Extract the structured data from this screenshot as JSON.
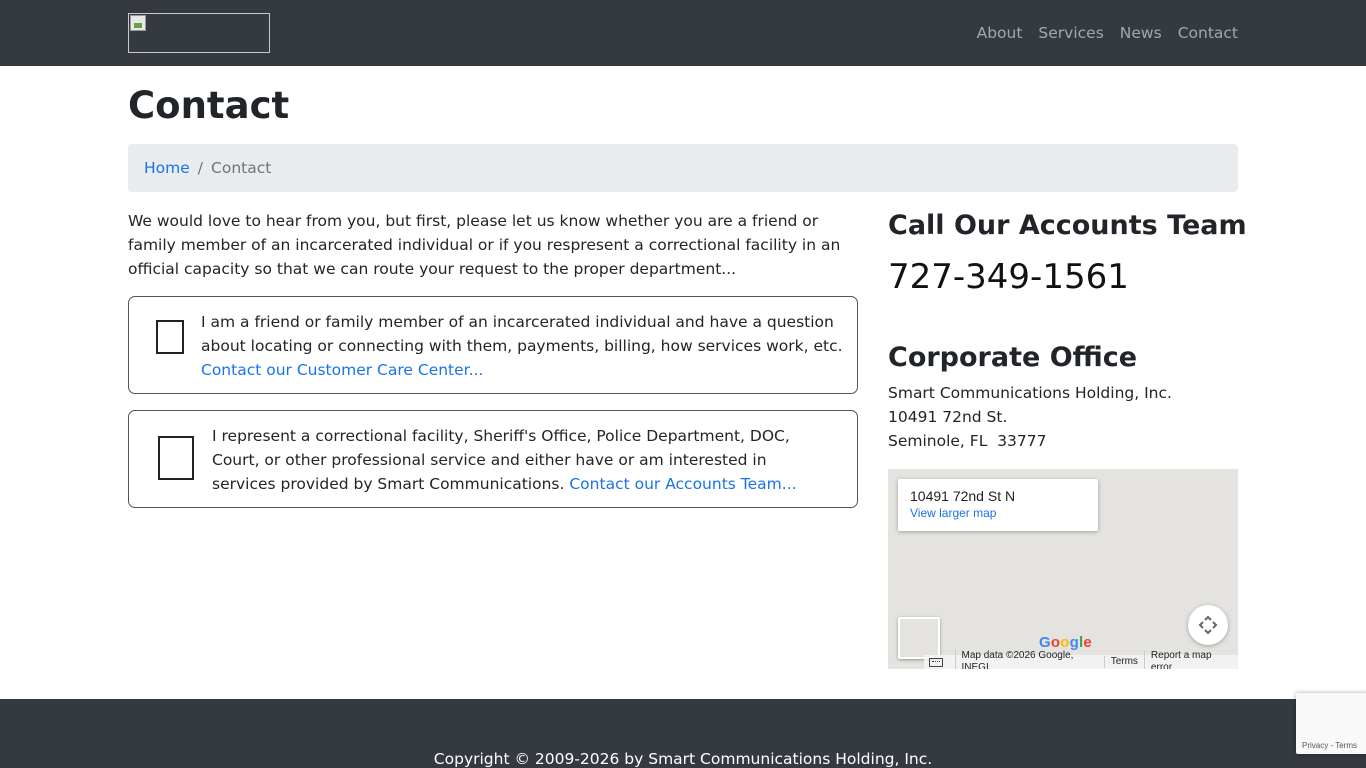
{
  "nav": {
    "logo_icon": "broken-image-icon",
    "items": [
      {
        "label": "About"
      },
      {
        "label": "Services"
      },
      {
        "label": "News"
      },
      {
        "label": "Contact"
      }
    ]
  },
  "page": {
    "title": "Contact"
  },
  "breadcrumb": {
    "home": "Home",
    "separator": "/",
    "current": "Contact"
  },
  "intro": "We would love to hear from you, but first, please let us know whether you are a friend or family member of an incarcerated individual or if you respresent a correctional facility in an official capacity so that we can route your request to the proper department...",
  "options": {
    "friend": {
      "text": "I am a friend or family member of an incarcerated individual and have a question about locating or connecting with them, payments, billing, how services work, etc.",
      "link": "Contact our Customer Care Center..."
    },
    "facility": {
      "text": "I represent a correctional facility, Sheriff's Office, Police Department, DOC, Court, or other professional service and either have or am interested in services provided by Smart Communications.",
      "link": "Contact our Accounts Team..."
    }
  },
  "accounts": {
    "heading": "Call Our Accounts Team",
    "phone": "727-349-1561"
  },
  "office": {
    "heading": "Corporate Office",
    "company": "Smart Communications Holding, Inc.",
    "street": "10491 72nd St.",
    "city": "Seminole, FL  33777"
  },
  "map": {
    "address": "10491 72nd St N",
    "larger_map": "View larger map",
    "logo": [
      "G",
      "o",
      "o",
      "g",
      "l",
      "e"
    ],
    "map_data": "Map data ©2026 Google, INEGI",
    "terms": "Terms",
    "report": "Report a map error"
  },
  "footer": {
    "copyright": "Copyright © 2009-2026 by Smart Communications Holding, Inc."
  },
  "recaptcha": {
    "privacy": "Privacy",
    "dash": "-",
    "terms": "Terms"
  },
  "colors": {
    "navbar": "#343a40",
    "link": "#1a73e8",
    "breadcrumb_bg": "#e9ecef",
    "map_bg": "#e5e3df"
  }
}
